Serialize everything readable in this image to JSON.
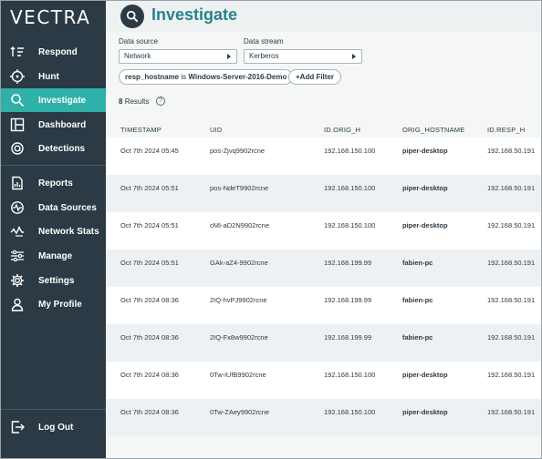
{
  "brand": {
    "logo_text": "VECTRA"
  },
  "sidebar": {
    "items": [
      {
        "label": "Respond",
        "icon": "respond-icon"
      },
      {
        "label": "Hunt",
        "icon": "crosshair-icon"
      },
      {
        "label": "Investigate",
        "icon": "search-icon",
        "active": true
      },
      {
        "label": "Dashboard",
        "icon": "dashboard-icon"
      },
      {
        "label": "Detections",
        "icon": "detections-icon"
      },
      {
        "label": "Reports",
        "icon": "report-icon"
      },
      {
        "label": "Data Sources",
        "icon": "data-sources-icon"
      },
      {
        "label": "Network Stats",
        "icon": "network-stats-icon"
      },
      {
        "label": "Manage",
        "icon": "sliders-icon"
      },
      {
        "label": "Settings",
        "icon": "gear-icon"
      },
      {
        "label": "My Profile",
        "icon": "user-icon"
      }
    ],
    "logout_label": "Log Out"
  },
  "header": {
    "title": "Investigate"
  },
  "filters": {
    "data_source_label": "Data source",
    "data_source_value": "Network",
    "data_stream_label": "Data stream",
    "data_stream_value": "Kerberos",
    "chip_field": "resp_hostname",
    "chip_op": "is",
    "chip_value": "Windows-Server-2016-Demo",
    "add_filter_label": "+Add Filter"
  },
  "results": {
    "count": "8",
    "label": "Results",
    "help": "?"
  },
  "table": {
    "columns": [
      "TIMESTAMP",
      "UID",
      "ID.ORIG_H",
      "ORIG_HOSTNAME",
      "ID.RESP_H"
    ],
    "rows": [
      [
        "Oct 7th 2024 05:45",
        "pos-Zjvq9902rcne",
        "192.168.150.100",
        "piper-desktop",
        "192.168.50.191"
      ],
      [
        "Oct 7th 2024 05:51",
        "pos-NdeT9902rcne",
        "192.168.150.100",
        "piper-desktop",
        "192.168.50.191"
      ],
      [
        "Oct 7th 2024 05:51",
        "cMI-aD2N9902rcne",
        "192.168.150.100",
        "piper-desktop",
        "192.168.50.191"
      ],
      [
        "Oct 7th 2024 05:51",
        "GAk-aZ4-9902rcne",
        "192.168.199.99",
        "fabien-pc",
        "192.168.50.191"
      ],
      [
        "Oct 7th 2024 08:36",
        "2IQ-hvPJ9902rcne",
        "192.168.199.99",
        "fabien-pc",
        "192.168.50.191"
      ],
      [
        "Oct 7th 2024 08:36",
        "2IQ-Fx8w9902rcne",
        "192.168.199.99",
        "fabien-pc",
        "192.168.50.191"
      ],
      [
        "Oct 7th 2024 08:36",
        "0Tw-iUfB9902rcne",
        "192.168.150.100",
        "piper-desktop",
        "192.168.50.191"
      ],
      [
        "Oct 7th 2024 08:36",
        "0Tw-ZAey9902rcne",
        "192.168.150.100",
        "piper-desktop",
        "192.168.50.191"
      ]
    ]
  },
  "colors": {
    "sidebar_bg": "#2b3a44",
    "accent": "#2fb0a8",
    "title": "#26848a"
  }
}
